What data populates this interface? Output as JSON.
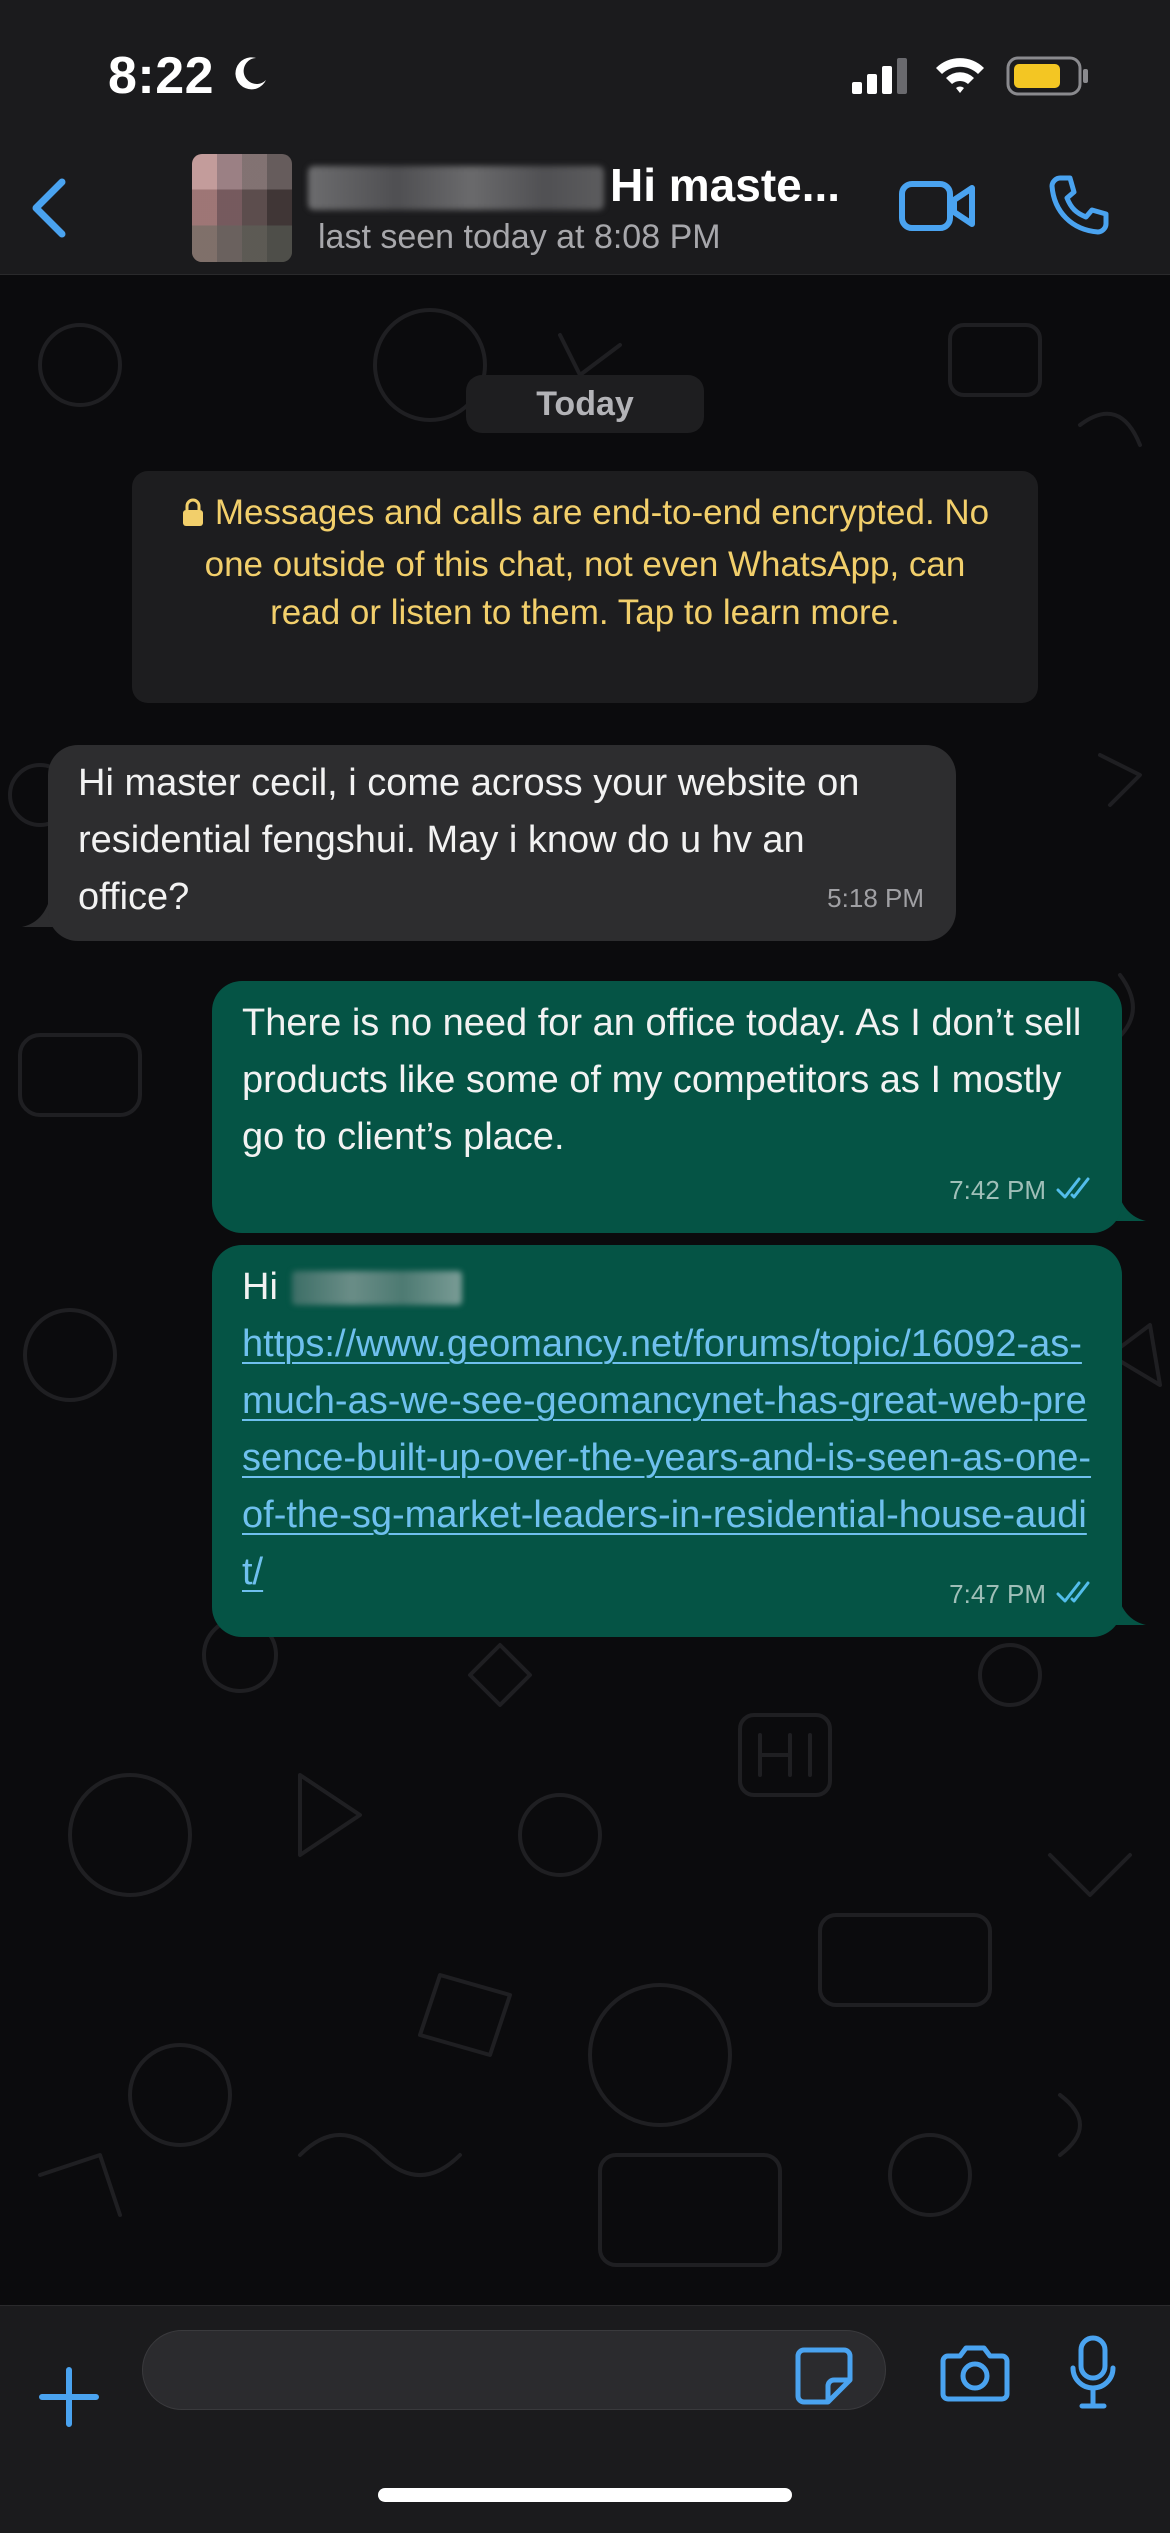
{
  "status_bar": {
    "time": "8:22"
  },
  "header": {
    "contact_name": "Hi maste...",
    "last_seen": "last seen today at 8:08 PM"
  },
  "chat": {
    "date_label": "Today",
    "encryption_notice": "Messages and calls are end-to-end encrypted. No one outside of this chat, not even WhatsApp, can read or listen to them. Tap to learn more.",
    "messages": [
      {
        "direction": "incoming",
        "text": "Hi master cecil, i come across your website on residential  fengshui. May i know do u hv an office?",
        "time": "5:18 PM"
      },
      {
        "direction": "outgoing",
        "text": "There is no need for an office today. As I don’t sell products like some of my competitors as I mostly go to client’s place.",
        "time": "7:42 PM",
        "status": "read"
      },
      {
        "direction": "outgoing",
        "greeting": "Hi",
        "link": "https://www.geomancy.net/forums/topic/16092-as-much-as-we-see-geomancynet-has-great-web-presence-built-up-over-the-years-and-is-seen-as-one-of-the-sg-market-leaders-in-residential-house-audit/",
        "time": "7:47 PM",
        "status": "read"
      }
    ]
  },
  "composer": {
    "input_value": "",
    "input_placeholder": ""
  },
  "colors": {
    "accent": "#4aa3f0",
    "outgoing_bubble": "#055445",
    "incoming_bubble": "#2d2d2f",
    "encryption_text": "#f2cf6b",
    "link": "#6fc0ee"
  },
  "icons": [
    "moon-icon",
    "signal-icon",
    "wifi-icon",
    "battery-icon",
    "back-icon",
    "video-call-icon",
    "phone-icon",
    "lock-icon",
    "double-check-icon",
    "plus-icon",
    "sticker-icon",
    "camera-icon",
    "microphone-icon"
  ]
}
